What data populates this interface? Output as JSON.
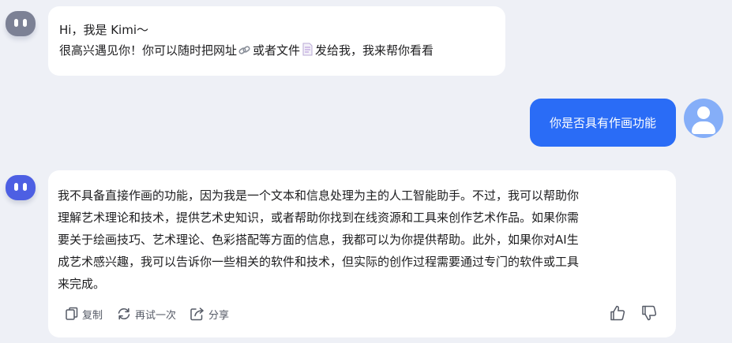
{
  "messages": {
    "greeting": {
      "line1": "Hi，我是 Kimi～",
      "line2_part1": "很高兴遇见你！你可以随时把网址",
      "line2_part2": "或者文件",
      "line2_part3": "发给我，我来帮你看看",
      "link_icon": "link-emoji-icon",
      "file_icon": "document-emoji-icon"
    },
    "user_question": "你是否具有作画功能",
    "answer": {
      "line1": "我不具备直接作画的功能，因为我是一个文本和信息处理为主的人工智能助手。不过，我可以帮助你",
      "line2": "理解艺术理论和技术，提供艺术史知识，或者帮助你找到在线资源和工具来创作艺术作品。如果你需",
      "line3": "要关于绘画技巧、艺术理论、色彩搭配等方面的信息，我都可以为你提供帮助。此外，如果你对AI生",
      "line4": "成艺术感兴趣，我可以告诉你一些相关的软件和技术，但实际的创作过程需要通过专门的软件或工具",
      "line5": "来完成。"
    }
  },
  "actions": {
    "copy_label": "复制",
    "retry_label": "再试一次",
    "share_label": "分享",
    "like_icon": "thumbs-up-icon",
    "dislike_icon": "thumbs-down-icon"
  },
  "colors": {
    "background": "#eef0f6",
    "user_bubble": "#2a6cf6",
    "user_avatar": "#85aef8",
    "bot_avatar_inactive": "#7c8195",
    "bot_avatar_active": "#4d5fe3"
  }
}
